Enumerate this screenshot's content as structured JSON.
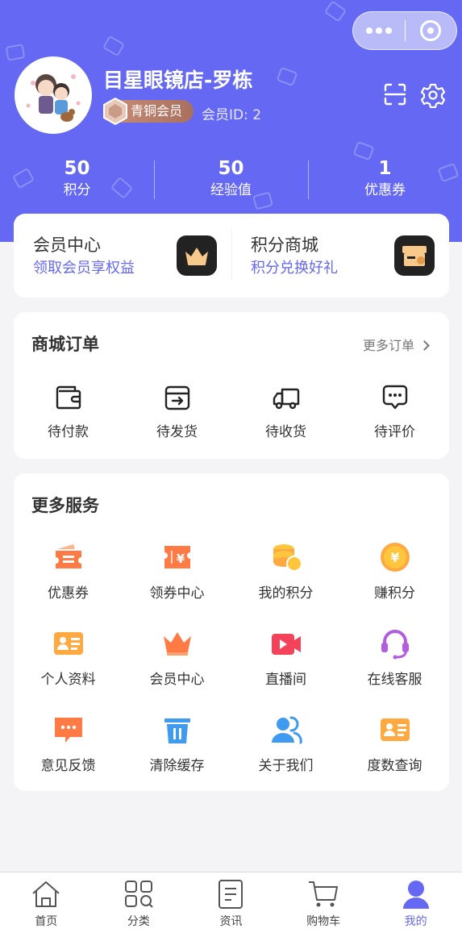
{
  "profile": {
    "nickname": "目星眼镜店-罗栋",
    "level": "青铜会员",
    "member_id": "会员ID: 2"
  },
  "stats": [
    {
      "value": "50",
      "label": "积分"
    },
    {
      "value": "50",
      "label": "经验值"
    },
    {
      "value": "1",
      "label": "优惠券"
    }
  ],
  "promo": [
    {
      "title": "会员中心",
      "subtitle": "领取会员享权益",
      "icon": "crown-icon"
    },
    {
      "title": "积分商城",
      "subtitle": "积分兑换好礼",
      "icon": "store-icon"
    }
  ],
  "orders": {
    "title": "商城订单",
    "more": "更多订单",
    "items": [
      {
        "label": "待付款",
        "icon": "wallet-icon"
      },
      {
        "label": "待发货",
        "icon": "box-out-icon"
      },
      {
        "label": "待收货",
        "icon": "truck-icon"
      },
      {
        "label": "待评价",
        "icon": "comment-icon"
      }
    ]
  },
  "services": {
    "title": "更多服务",
    "items": [
      {
        "label": "优惠券",
        "icon": "coupon-icon"
      },
      {
        "label": "领券中心",
        "icon": "ticket-icon"
      },
      {
        "label": "我的积分",
        "icon": "coins-icon"
      },
      {
        "label": "赚积分",
        "icon": "yen-coin-icon"
      },
      {
        "label": "个人资料",
        "icon": "id-card-icon"
      },
      {
        "label": "会员中心",
        "icon": "crown-icon"
      },
      {
        "label": "直播间",
        "icon": "video-icon"
      },
      {
        "label": "在线客服",
        "icon": "headset-icon"
      },
      {
        "label": "意见反馈",
        "icon": "feedback-icon"
      },
      {
        "label": "清除缓存",
        "icon": "trash-icon"
      },
      {
        "label": "关于我们",
        "icon": "users-icon"
      },
      {
        "label": "度数查询",
        "icon": "id-card-icon"
      }
    ]
  },
  "tabbar": [
    {
      "label": "首页",
      "icon": "home-icon"
    },
    {
      "label": "分类",
      "icon": "category-icon"
    },
    {
      "label": "资讯",
      "icon": "news-icon"
    },
    {
      "label": "购物车",
      "icon": "cart-icon"
    },
    {
      "label": "我的",
      "icon": "user-icon",
      "active": true
    }
  ],
  "colors": {
    "accent": "#6468f2",
    "header_bg": "#6468f2",
    "page_bg": "#f4f4f6"
  }
}
